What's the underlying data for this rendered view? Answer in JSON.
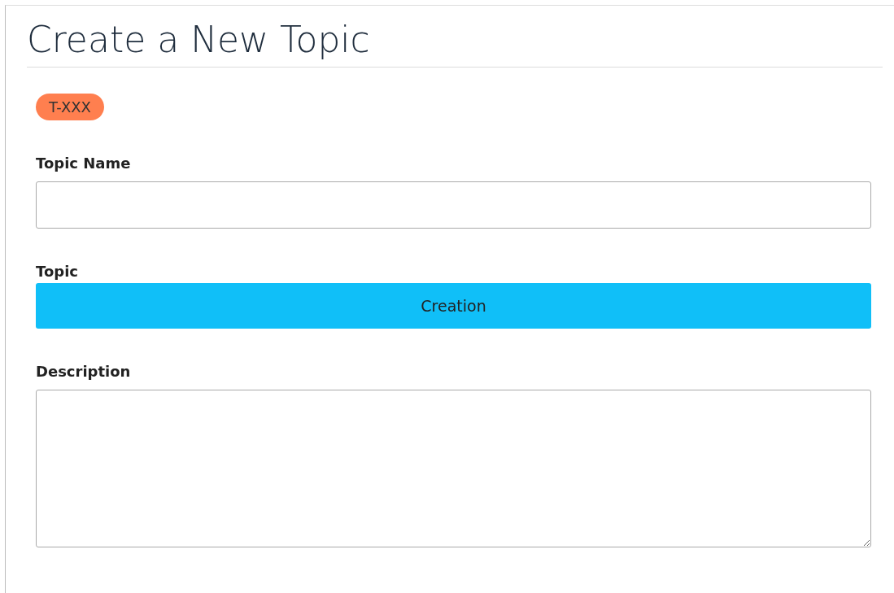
{
  "title": "Create a New Topic",
  "badge": "T-XXX",
  "fields": [
    {
      "kind": "input",
      "label": "Topic Name"
    },
    {
      "kind": "button",
      "label": "Topic",
      "value": "Creation"
    },
    {
      "kind": "textarea",
      "label": "Description"
    }
  ]
}
